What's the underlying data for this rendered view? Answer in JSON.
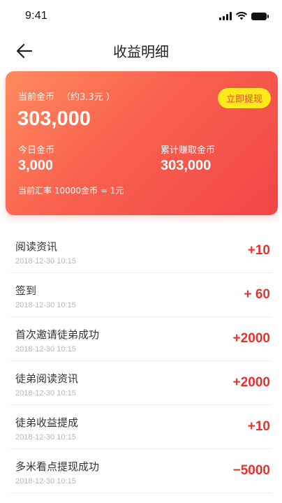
{
  "status": {
    "time": "9:41",
    "icons": [
      "signal-icon",
      "wifi-icon",
      "battery-icon"
    ]
  },
  "nav": {
    "back_icon": "arrow-left-icon",
    "title": "收益明细"
  },
  "card": {
    "current_label": "当前金币",
    "current_approx": "（约3.3元 ）",
    "current_value": "303,000",
    "withdraw_label": "立即提现",
    "today_label": "今日金币",
    "today_value": "3,000",
    "total_label": "累计赚取金币",
    "total_value": "303,000",
    "rate_text": "当前汇率 10000金币 = 1元",
    "colors": {
      "gradient_start": "#ff8a5e",
      "gradient_end": "#f04646",
      "button_bg": "#ffe81c",
      "button_text": "#e9462e"
    }
  },
  "records": [
    {
      "title": "阅读资讯",
      "time": "2018-12-30 10:15",
      "amount": "+10"
    },
    {
      "title": "签到",
      "time": "2018-12-30 10:15",
      "amount": "+ 60"
    },
    {
      "title": "首次邀请徒弟成功",
      "time": "2018-12-30 10:15",
      "amount": "+2000"
    },
    {
      "title": "徒弟阅读资讯",
      "time": "2018-12-30 10:15",
      "amount": "+2000"
    },
    {
      "title": "徒弟收益提成",
      "time": "2018-12-30 10:15",
      "amount": "+10"
    },
    {
      "title": "多米看点提现成功",
      "time": "2018-12-30 10:15",
      "amount": "−5000"
    }
  ],
  "colors": {
    "amount": "#e8302c",
    "timestamp": "#b7b7b7"
  }
}
